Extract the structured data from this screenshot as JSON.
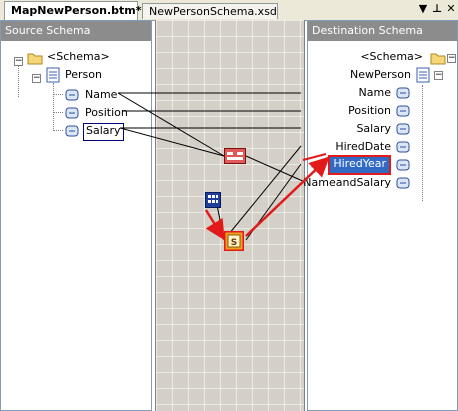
{
  "tabs": [
    {
      "label": "MapNewPerson.btm*",
      "active": true
    },
    {
      "label": "NewPersonSchema.xsd",
      "active": false
    }
  ],
  "window_controls": {
    "menu_glyph": "▼",
    "pin_glyph": "⊥",
    "close_glyph": "✕"
  },
  "source": {
    "header": "Source Schema",
    "root": "<Schema>",
    "record": "Person",
    "fields": [
      "Name",
      "Position",
      "Salary"
    ]
  },
  "destination": {
    "header": "Destination Schema",
    "root": "<Schema>",
    "record": "NewPerson",
    "fields": [
      "Name",
      "Position",
      "Salary",
      "HiredDate",
      "HiredYear",
      "NameandSalary"
    ]
  },
  "functoids": [
    {
      "id": "string-concat",
      "icon": "string-concatenate-functoid-icon"
    },
    {
      "id": "date-time",
      "icon": "date-time-functoid-icon"
    },
    {
      "id": "scripting",
      "icon": "scripting-functoid-icon"
    }
  ],
  "colors": {
    "header_bg": "#8c8c8c",
    "grid_bg": "#d4d0c8",
    "selection": "#316ac5",
    "highlight_red": "#e21a1a"
  }
}
